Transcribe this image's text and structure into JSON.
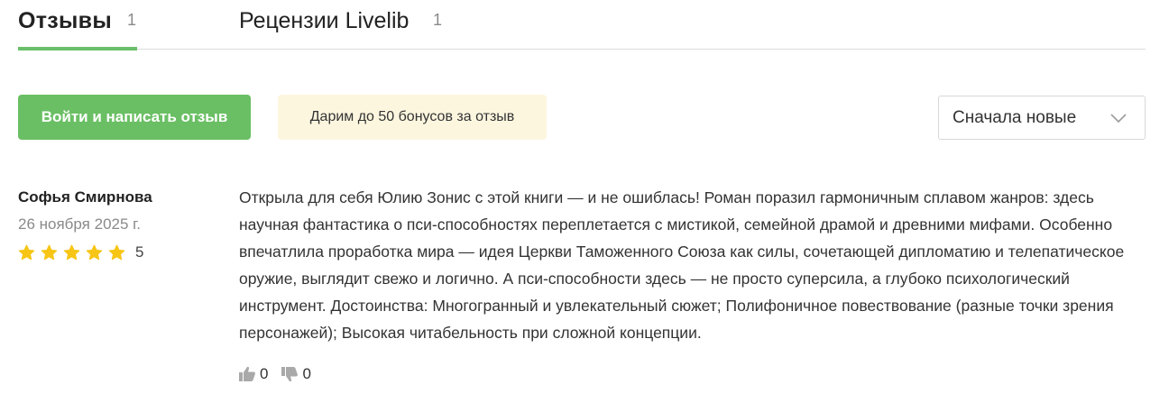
{
  "tabs": [
    {
      "label": "Отзывы",
      "count": "1",
      "active": true
    },
    {
      "label": "Рецензии Livelib",
      "count": "1",
      "active": false
    }
  ],
  "actions": {
    "write_button_label": "Войти и написать отзыв",
    "bonus_text": "Дарим до 50 бонусов за отзыв",
    "sort_selected": "Сначала новые"
  },
  "review": {
    "author": "Софья Смирнова",
    "date": "26 ноября 2025 г.",
    "rating": "5",
    "rating_stars": 5,
    "text": "Открыла для себя Юлию Зонис с этой книги — и не ошиблась! Роман поразил гармоничным сплавом жанров: здесь научная фантастика о пси-способностях переплетается с мистикой, семейной драмой и древними мифами. Особенно впечатлила проработка мира — идея Церкви Таможенного Союза как силы, сочетающей дипломатию и телепатическое оружие, выглядит свежо и логично. А пси-способности здесь — не просто суперсила, а глубоко психологический инструмент. Достоинства: Многогранный и увлекательный сюжет; Полифоничное повествование (разные точки зрения персонажей); Высокая читабельность при сложной концепции.",
    "likes": "0",
    "dislikes": "0"
  },
  "colors": {
    "accent_green": "#6abf64",
    "star_yellow": "#f7c515",
    "bonus_bg": "#fdf6df",
    "vote_icon": "#a9a9a9"
  },
  "icons": {
    "star": "star-icon",
    "like": "thumbs-up-icon",
    "dislike": "thumbs-down-icon",
    "dropdown": "chevron-down-icon"
  }
}
